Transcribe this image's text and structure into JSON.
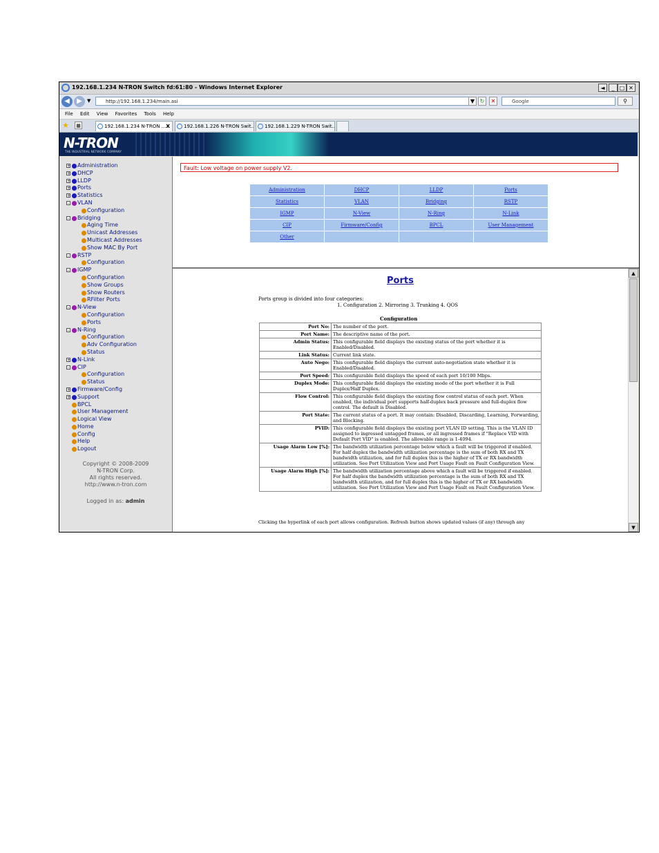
{
  "window": {
    "title": "192.168.1.234 N-TRON Switch fd:61:80 - Windows Internet Explorer",
    "controls": {
      "minimize": "_",
      "maximize": "□",
      "close": "✕",
      "back": "◄"
    }
  },
  "address_bar": {
    "url": "http://192.168.1.234/main.asi",
    "search_placeholder": "Google"
  },
  "menu": [
    "File",
    "Edit",
    "View",
    "Favorites",
    "Tools",
    "Help"
  ],
  "tabs": [
    {
      "label": "192.168.1.234 N-TRON ..."
    },
    {
      "label": "192.168.1.226 N-TRON Swit..."
    },
    {
      "label": "192.168.1.229 N-TRON Swit..."
    }
  ],
  "banner": {
    "logo": "N-TRON",
    "tagline": "THE INDUSTRIAL NETWORK COMPANY"
  },
  "sidebar": {
    "items": [
      {
        "label": "Administration",
        "level": 0,
        "toggle": "+"
      },
      {
        "label": "DHCP",
        "level": 0,
        "toggle": "+"
      },
      {
        "label": "LLDP",
        "level": 0,
        "toggle": "+"
      },
      {
        "label": "Ports",
        "level": 0,
        "toggle": "+"
      },
      {
        "label": "Statistics",
        "level": 0,
        "toggle": "+"
      },
      {
        "label": "VLAN",
        "level": 0,
        "toggle": "-"
      },
      {
        "label": "Configuration",
        "level": 1,
        "toggle": ""
      },
      {
        "label": "Bridging",
        "level": 0,
        "toggle": "-"
      },
      {
        "label": "Aging Time",
        "level": 1,
        "toggle": ""
      },
      {
        "label": "Unicast Addresses",
        "level": 1,
        "toggle": ""
      },
      {
        "label": "Multicast Addresses",
        "level": 1,
        "toggle": ""
      },
      {
        "label": "Show MAC By Port",
        "level": 1,
        "toggle": ""
      },
      {
        "label": "RSTP",
        "level": 0,
        "toggle": "-"
      },
      {
        "label": "Configuration",
        "level": 1,
        "toggle": ""
      },
      {
        "label": "IGMP",
        "level": 0,
        "toggle": "-"
      },
      {
        "label": "Configuration",
        "level": 1,
        "toggle": ""
      },
      {
        "label": "Show Groups",
        "level": 1,
        "toggle": ""
      },
      {
        "label": "Show Routers",
        "level": 1,
        "toggle": ""
      },
      {
        "label": "RFilter Ports",
        "level": 1,
        "toggle": ""
      },
      {
        "label": "N-View",
        "level": 0,
        "toggle": "-"
      },
      {
        "label": "Configuration",
        "level": 1,
        "toggle": ""
      },
      {
        "label": "Ports",
        "level": 1,
        "toggle": ""
      },
      {
        "label": "N-Ring",
        "level": 0,
        "toggle": "-"
      },
      {
        "label": "Configuration",
        "level": 1,
        "toggle": ""
      },
      {
        "label": "Adv Configuration",
        "level": 1,
        "toggle": ""
      },
      {
        "label": "Status",
        "level": 1,
        "toggle": ""
      },
      {
        "label": "N-Link",
        "level": 0,
        "toggle": "+"
      },
      {
        "label": "CIP",
        "level": 0,
        "toggle": "-"
      },
      {
        "label": "Configuration",
        "level": 1,
        "toggle": ""
      },
      {
        "label": "Status",
        "level": 1,
        "toggle": ""
      },
      {
        "label": "Firmware/Config",
        "level": 0,
        "toggle": "+"
      },
      {
        "label": "Support",
        "level": 0,
        "toggle": "+"
      },
      {
        "label": "BPCL",
        "level": 0,
        "toggle": ""
      },
      {
        "label": "User Management",
        "level": 0,
        "toggle": ""
      },
      {
        "label": "Logical View",
        "level": 0,
        "toggle": ""
      },
      {
        "label": "Home",
        "level": 0,
        "toggle": ""
      },
      {
        "label": "Config",
        "level": 0,
        "toggle": ""
      },
      {
        "label": "Help",
        "level": 0,
        "toggle": ""
      },
      {
        "label": "Logout",
        "level": 0,
        "toggle": ""
      }
    ],
    "copyright": [
      "Copyright © 2008-2009",
      "N-TRON Corp.",
      "All rights reserved.",
      "http://www.n-tron.com"
    ],
    "logged_in_prefix": "Logged in as:",
    "logged_in_user": "admin"
  },
  "fault_message": "Fault:  Low voltage on power supply V2.",
  "nav_links": [
    [
      "Administration",
      "DHCP",
      "LLDP",
      "Ports"
    ],
    [
      "Statistics",
      "VLAN",
      "Bridging",
      "RSTP"
    ],
    [
      "IGMP",
      "N-View",
      "N-Ring",
      "N-Link"
    ],
    [
      "CIP",
      "Firmware/Config",
      "BPCL",
      "User Management"
    ],
    [
      "Other",
      "",
      "",
      ""
    ]
  ],
  "main": {
    "title": "Ports",
    "intro": "Ports group is divided into four categories:",
    "categories": "1. Configuration   2. Mirroring   3. Trunking   4. QOS",
    "config_caption": "Configuration",
    "rows": [
      {
        "key": "Port No:",
        "value": "The number of the port."
      },
      {
        "key": "Port Name:",
        "value": "The descriptive name of the port."
      },
      {
        "key": "Admin Status:",
        "value": "This configurable field displays the existing status of the port whether it is Enabled/Disabled."
      },
      {
        "key": "Link Status:",
        "value": "Current link state."
      },
      {
        "key": "Auto Nego:",
        "value": "This configurable field displays the current auto-negotiation state whether it is Enabled/Disabled."
      },
      {
        "key": "Port Speed:",
        "value": "This configurable field displays the speed of each port 10/100 Mbps."
      },
      {
        "key": "Duplex Mode:",
        "value": "This configurable field displays the existing mode of the port whether it is Full Duplex/Half Duplex."
      },
      {
        "key": "Flow Control:",
        "value": "This configurable field displays the existing flow control status of each port. When enabled, the individual port supports half-duplex back pressure and full-duplex flow control. The default is Disabled."
      },
      {
        "key": "Port State:",
        "value": "The current status of a port. It may contain: Disabled, Discarding, Learning, Forwarding, and Blocking."
      },
      {
        "key": "PVID:",
        "value": "This configurable field displays the existing port VLAN ID setting. This is the VLAN ID assigned to ingressed untagged frames, or all ingressed frames if \"Replace VID with Default Port VID\" is enabled. The allowable range is 1-4094."
      },
      {
        "key": "Usage Alarm Low [%]:",
        "value": "The bandwidth utilization percentage below which a fault will be triggered if enabled. For half duplex the bandwidth utilization percentage is the sum of both RX and TX bandwidth utilization, and for full duplex this is the higher of TX or RX bandwidth utilization. See Port Utilization View and Port Usage Fault on Fault Configuration View."
      },
      {
        "key": "Usage Alarm High [%]:",
        "value": "The bandwidth utilization percentage above which a fault will be triggered if enabled. For half duplex the bandwidth utilization percentage is the sum of both RX and TX bandwidth utilization, and for full duplex this is the higher of TX or RX bandwidth utilization. See Port Utilization View and Port Usage Fault on Fault Configuration View."
      }
    ],
    "footnote": "Clicking the hyperlink of each port allows configuration. Refresh button shows updated values (if any) through any"
  },
  "colors": {
    "banner": "#0a2556",
    "link": "#1a1ac0",
    "fault": "#d00000",
    "nav_table": "#a9c6ec"
  }
}
